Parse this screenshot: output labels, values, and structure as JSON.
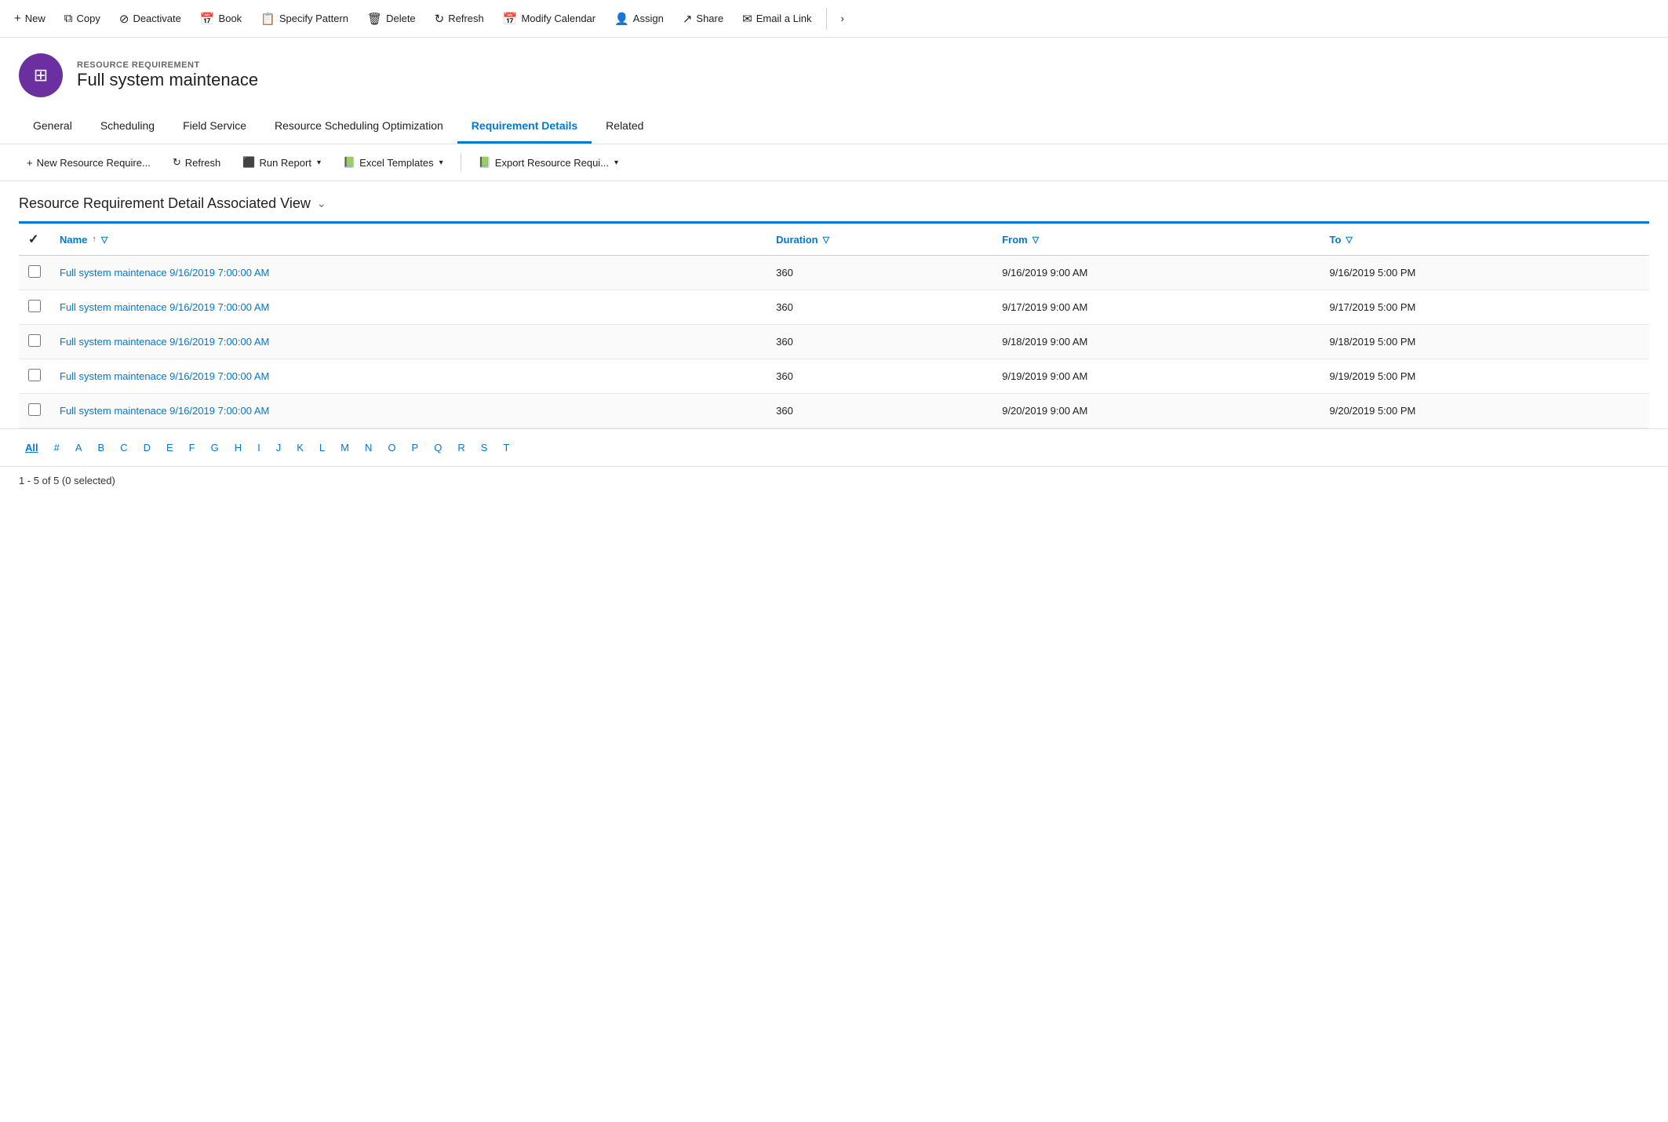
{
  "toolbar": {
    "buttons": [
      {
        "id": "new",
        "label": "New",
        "icon": "+"
      },
      {
        "id": "copy",
        "label": "Copy",
        "icon": "⧉"
      },
      {
        "id": "deactivate",
        "label": "Deactivate",
        "icon": "⊘"
      },
      {
        "id": "book",
        "label": "Book",
        "icon": "📅"
      },
      {
        "id": "specify-pattern",
        "label": "Specify Pattern",
        "icon": "📋"
      },
      {
        "id": "delete",
        "label": "Delete",
        "icon": "🗑"
      },
      {
        "id": "refresh",
        "label": "Refresh",
        "icon": "↻"
      },
      {
        "id": "modify-calendar",
        "label": "Modify Calendar",
        "icon": "📅"
      },
      {
        "id": "assign",
        "label": "Assign",
        "icon": "👤"
      },
      {
        "id": "share",
        "label": "Share",
        "icon": "↗"
      },
      {
        "id": "email-link",
        "label": "Email a Link",
        "icon": "✉"
      }
    ]
  },
  "record": {
    "type": "RESOURCE REQUIREMENT",
    "name": "Full system maintenace",
    "avatar_icon": "⊞"
  },
  "nav_tabs": [
    {
      "id": "general",
      "label": "General",
      "active": false
    },
    {
      "id": "scheduling",
      "label": "Scheduling",
      "active": false
    },
    {
      "id": "field-service",
      "label": "Field Service",
      "active": false
    },
    {
      "id": "resource-scheduling",
      "label": "Resource Scheduling Optimization",
      "active": false
    },
    {
      "id": "requirement-details",
      "label": "Requirement Details",
      "active": true
    },
    {
      "id": "related",
      "label": "Related",
      "active": false
    }
  ],
  "sub_toolbar": {
    "buttons": [
      {
        "id": "new-resource",
        "label": "New Resource Require...",
        "icon": "+"
      },
      {
        "id": "refresh",
        "label": "Refresh",
        "icon": "↻"
      },
      {
        "id": "run-report",
        "label": "Run Report",
        "icon": "📊",
        "dropdown": true
      },
      {
        "id": "excel-templates",
        "label": "Excel Templates",
        "icon": "📗",
        "dropdown": true
      },
      {
        "id": "export-resource",
        "label": "Export Resource Requi...",
        "icon": "📗",
        "dropdown": true
      }
    ]
  },
  "view_title": "Resource Requirement Detail Associated View",
  "table": {
    "columns": [
      {
        "id": "name",
        "label": "Name",
        "sortable": true,
        "filterable": true
      },
      {
        "id": "duration",
        "label": "Duration",
        "filterable": true
      },
      {
        "id": "from",
        "label": "From",
        "filterable": true
      },
      {
        "id": "to",
        "label": "To",
        "filterable": true
      }
    ],
    "rows": [
      {
        "id": 1,
        "name": "Full system maintenace 9/16/2019 7:00:00 AM",
        "duration": "360",
        "from": "9/16/2019 9:00 AM",
        "to": "9/16/2019 5:00 PM"
      },
      {
        "id": 2,
        "name": "Full system maintenace 9/16/2019 7:00:00 AM",
        "duration": "360",
        "from": "9/17/2019 9:00 AM",
        "to": "9/17/2019 5:00 PM"
      },
      {
        "id": 3,
        "name": "Full system maintenace 9/16/2019 7:00:00 AM",
        "duration": "360",
        "from": "9/18/2019 9:00 AM",
        "to": "9/18/2019 5:00 PM"
      },
      {
        "id": 4,
        "name": "Full system maintenace 9/16/2019 7:00:00 AM",
        "duration": "360",
        "from": "9/19/2019 9:00 AM",
        "to": "9/19/2019 5:00 PM"
      },
      {
        "id": 5,
        "name": "Full system maintenace 9/16/2019 7:00:00 AM",
        "duration": "360",
        "from": "9/20/2019 9:00 AM",
        "to": "9/20/2019 5:00 PM"
      }
    ]
  },
  "pagination": {
    "letters": [
      "All",
      "#",
      "A",
      "B",
      "C",
      "D",
      "E",
      "F",
      "G",
      "H",
      "I",
      "J",
      "K",
      "L",
      "M",
      "N",
      "O",
      "P",
      "Q",
      "R",
      "S",
      "T"
    ],
    "active": "All"
  },
  "status": {
    "text": "1 - 5 of 5 (0 selected)"
  }
}
